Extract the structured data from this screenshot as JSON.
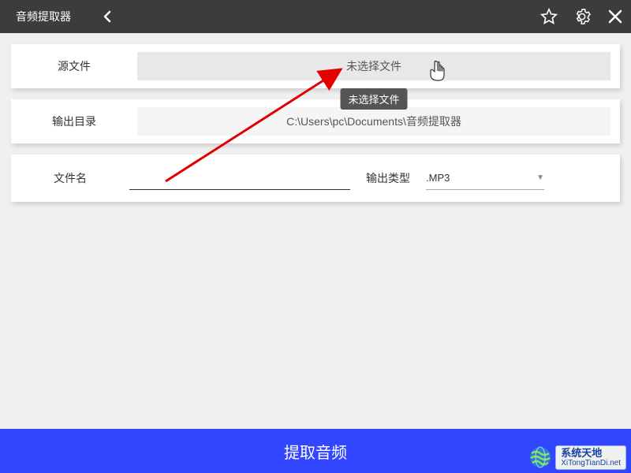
{
  "titlebar": {
    "title": "音频提取器"
  },
  "source": {
    "label": "源文件",
    "value": "未选择文件",
    "tooltip": "未选择文件"
  },
  "output_dir": {
    "label": "输出目录",
    "value": "C:\\Users\\pc\\Documents\\音频提取器"
  },
  "filename": {
    "label": "文件名",
    "value": ""
  },
  "output_type": {
    "label": "输出类型",
    "selected": ".MP3"
  },
  "action": {
    "extract_label": "提取音频"
  },
  "watermark": {
    "name": "系统天地",
    "url": "XiTongTianDi.net"
  }
}
